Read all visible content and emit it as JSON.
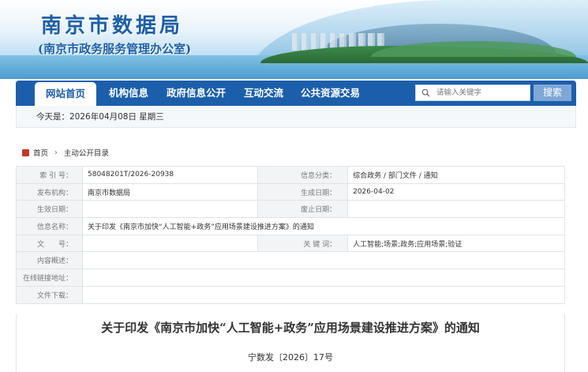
{
  "header": {
    "site_title": "南京市数据局",
    "site_subtitle": "(南京市政务服务管理办公室)"
  },
  "nav": {
    "items": [
      {
        "label": "网站首页",
        "active": true
      },
      {
        "label": "机构信息",
        "active": false
      },
      {
        "label": "政府信息公开",
        "active": false
      },
      {
        "label": "互动交流",
        "active": false
      },
      {
        "label": "公共资源交易",
        "active": false
      }
    ],
    "search": {
      "placeholder": "请输入关键字",
      "button_label": "搜索"
    }
  },
  "datebar": {
    "text": "今天是：2026年04月08日 星期三"
  },
  "breadcrumb": {
    "home": "首页",
    "current": "主动公开目录"
  },
  "meta": {
    "rows": [
      {
        "label": "索 引 号：",
        "value": "58048201T/2026-20938",
        "label2": "信息分类：",
        "value2": "综合政务 / 部门文件 / 通知"
      },
      {
        "label": "发布机构：",
        "value": "南京市数据局",
        "label2": "生成日期：",
        "value2": "2026-04-02"
      },
      {
        "label": "生效日期：",
        "value": "",
        "label2": "废止日期：",
        "value2": ""
      },
      {
        "label": "信息名称：",
        "value": "关于印发《南京市加快“人工智能+政务”应用场景建设推进方案》的通知"
      },
      {
        "label": "文　　号：",
        "value": "",
        "label2": "关 键 词：",
        "value2": "人工智能;场景;政务;应用场景;验证"
      },
      {
        "label": "内容概述：",
        "value": ""
      },
      {
        "label": "在线链接地址：",
        "value": ""
      },
      {
        "label": "文件下载：",
        "value": ""
      }
    ]
  },
  "article": {
    "title": "关于印发《南京市加快“人工智能+政务”应用场景建设推进方案》的通知",
    "doc_number": "宁数发〔2026〕17号"
  },
  "colors": {
    "nav_bg": "#1b5fab",
    "title_blue": "#1e5fa5",
    "home_icon": "#c0392b"
  }
}
